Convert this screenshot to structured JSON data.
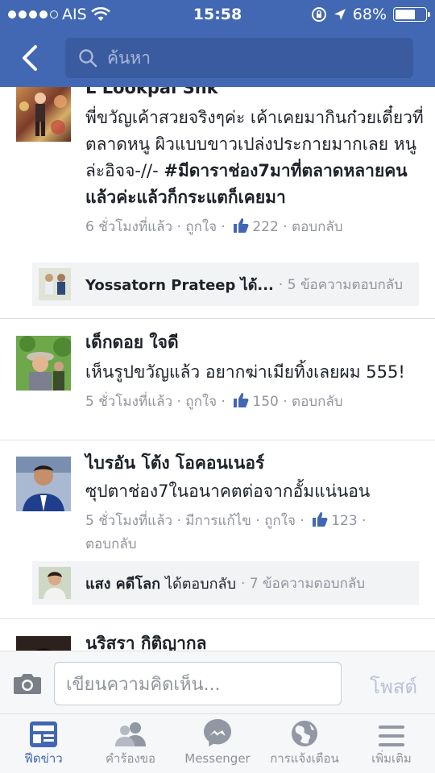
{
  "status_bar": {
    "carrier": "AIS",
    "time": "15:58",
    "battery": "68%",
    "battery_level": 0.68
  },
  "nav": {
    "search_placeholder": "ค้นหา"
  },
  "comments": [
    {
      "name": "L Lookpai Snk",
      "text_parts": [
        {
          "t": "พี่ขวัญเค้าสวยจริงๆค่ะ เค้าเคยมากินก๋วยเตี๋ยวที่ตลาดหนู ผิวแบบขาวเปล่งประกายมากเลย หนูล่ะอิจจ-//- ",
          "bold": false
        },
        {
          "t": "#มีดาราช่อง7มาที่ตลาดหลายคนแล้วค่ะแล้วก็กระแตก็เคยมา",
          "bold": true
        }
      ],
      "time": "6 ชั่วโมงที่แล้ว",
      "like_label": "ถูกใจ",
      "likes": "222",
      "reply_label": "ตอบกลับ",
      "reply_summary": {
        "name": "Yossatorn Prateep ได้...",
        "count": "5 ข้อความตอบกลับ"
      }
    },
    {
      "name": "เด็กดอย ใจดี",
      "text": "เห็นรูปขวัญแล้ว อยากฆ่าเมียทิ้งเลยผม 555!",
      "time": "5 ชั่วโมงที่แล้ว",
      "like_label": "ถูกใจ",
      "likes": "150",
      "reply_label": "ตอบกลับ"
    },
    {
      "name": "ไบรอัน โต้ง โอคอนเนอร์",
      "text": "ซุปตาช่อง7ในอนาคตต่อจากอั้มแน่นอน",
      "time": "5 ชั่วโมงที่แล้ว",
      "edited": "มีการแก้ไข",
      "like_label": "ถูกใจ",
      "likes": "123",
      "reply_label": "ตอบกลับ",
      "reply_summary": {
        "name": "แสง คดีโลก",
        "action": "ได้ตอบกลับ",
        "count": "7 ข้อความตอบกลับ"
      }
    },
    {
      "name": "นริสรา กิติญากล"
    }
  ],
  "composer": {
    "placeholder": "เขียนความคิดเห็น...",
    "post_label": "โพสต์"
  },
  "tabs": [
    {
      "label": "ฟีดข่าว",
      "icon": "news-feed-icon",
      "active": true
    },
    {
      "label": "คำร้องขอ",
      "icon": "friend-requests-icon"
    },
    {
      "label": "Messenger",
      "icon": "messenger-icon"
    },
    {
      "label": "การแจ้งเตือน",
      "icon": "globe-notifications-icon"
    },
    {
      "label": "เพิ่มเติม",
      "icon": "more-menu-icon"
    }
  ],
  "colors": {
    "brand": "#4268b3",
    "meta_text": "#90949c",
    "active_tab": "#4267b2"
  }
}
